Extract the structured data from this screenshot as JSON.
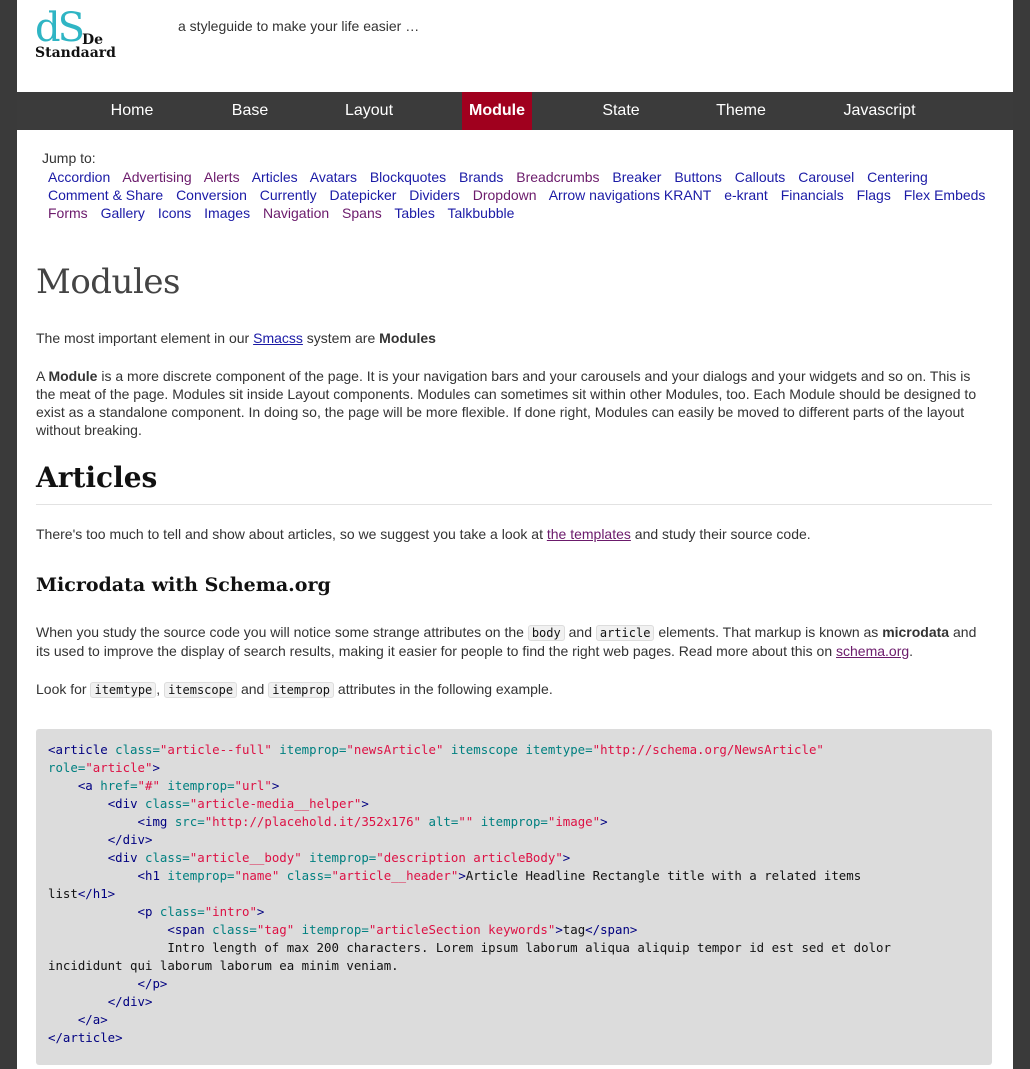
{
  "header": {
    "logo": {
      "ds": "dS",
      "de": "De",
      "standaard": "Standaard"
    },
    "tagline": "a styleguide to make your life easier …"
  },
  "nav": {
    "items": [
      {
        "label": "Home",
        "active": false
      },
      {
        "label": "Base",
        "active": false
      },
      {
        "label": "Layout",
        "active": false
      },
      {
        "label": "Module",
        "active": true
      },
      {
        "label": "State",
        "active": false
      },
      {
        "label": "Theme",
        "active": false
      },
      {
        "label": "Javascript",
        "active": false
      }
    ]
  },
  "jump": {
    "label": "Jump to:",
    "links": [
      "Accordion",
      "Advertising",
      "Alerts",
      "Articles",
      "Avatars",
      "Blockquotes",
      "Brands",
      "Breadcrumbs",
      "Breaker",
      "Buttons",
      "Callouts",
      "Carousel",
      "Centering",
      "Comment & Share",
      "Conversion",
      "Currently",
      "Datepicker",
      "Dividers",
      "Dropdown",
      "Arrow navigations KRANT",
      "e-krant",
      "Financials",
      "Flags",
      "Flex Embeds",
      "Forms",
      "Gallery",
      "Icons",
      "Images",
      "Navigation",
      "Spans",
      "Tables",
      "Talkbubble"
    ]
  },
  "content": {
    "title": "Modules",
    "intro": {
      "before": "The most important element in our ",
      "link": "Smacss",
      "after": " system are ",
      "strong": "Modules"
    },
    "module_para": {
      "before": "A ",
      "strong": "Module",
      "after": " is a more discrete component of the page. It is your navigation bars and your carousels and your dialogs and your widgets and so on. This is the meat of the page. Modules sit inside Layout components. Modules can sometimes sit within other Modules, too. Each Module should be designed to exist as a standalone component. In doing so, the page will be more flexible. If done right, Modules can easily be moved to different parts of the layout without breaking."
    },
    "articles_title": "Articles",
    "articles_para": {
      "before": "There's too much to tell and show about articles, so we suggest you take a look at ",
      "link": "the templates",
      "after": " and study their source code."
    },
    "micro_title": "Microdata with Schema.org",
    "micro_para": {
      "t1": "When you study the source code you will notice some strange attributes on the ",
      "c1": "body",
      "t2": " and ",
      "c2": "article",
      "t3": " elements. That markup is known as ",
      "strong": "microdata",
      "t4": " and its used to improve the display of search results, making it easier for people to find the right web pages. Read more about this on ",
      "link": "schema.org",
      "t5": "."
    },
    "look_para": {
      "t1": "Look for ",
      "c1": "itemtype",
      "t2": ", ",
      "c2": "itemscope",
      "t3": " and ",
      "c3": "itemprop",
      "t4": " attributes in the following example."
    }
  },
  "code_lines": [
    [
      [
        "t",
        "<article "
      ],
      [
        "a",
        "class="
      ],
      [
        "v",
        "\"article--full\""
      ],
      [
        "a",
        " itemprop="
      ],
      [
        "v",
        "\"newsArticle\""
      ],
      [
        "a",
        " itemscope itemtype="
      ],
      [
        "v",
        "\"http://schema.org/NewsArticle\""
      ]
    ],
    [
      [
        "a",
        "role="
      ],
      [
        "v",
        "\"article\""
      ],
      [
        "t",
        ">"
      ]
    ],
    [
      [
        "p",
        "    "
      ],
      [
        "t",
        "<a "
      ],
      [
        "a",
        "href="
      ],
      [
        "v",
        "\"#\""
      ],
      [
        "a",
        " itemprop="
      ],
      [
        "v",
        "\"url\""
      ],
      [
        "t",
        ">"
      ]
    ],
    [
      [
        "p",
        "        "
      ],
      [
        "t",
        "<div "
      ],
      [
        "a",
        "class="
      ],
      [
        "v",
        "\"article-media__helper\""
      ],
      [
        "t",
        ">"
      ]
    ],
    [
      [
        "p",
        "            "
      ],
      [
        "t",
        "<img "
      ],
      [
        "a",
        "src="
      ],
      [
        "v",
        "\"http://placehold.it/352x176\""
      ],
      [
        "a",
        " alt="
      ],
      [
        "v",
        "\"\""
      ],
      [
        "a",
        " itemprop="
      ],
      [
        "v",
        "\"image\""
      ],
      [
        "t",
        ">"
      ]
    ],
    [
      [
        "p",
        "        "
      ],
      [
        "t",
        "</div>"
      ]
    ],
    [
      [
        "p",
        "        "
      ],
      [
        "t",
        "<div "
      ],
      [
        "a",
        "class="
      ],
      [
        "v",
        "\"article__body\""
      ],
      [
        "a",
        " itemprop="
      ],
      [
        "v",
        "\"description articleBody\""
      ],
      [
        "t",
        ">"
      ]
    ],
    [
      [
        "p",
        "            "
      ],
      [
        "t",
        "<h1 "
      ],
      [
        "a",
        "itemprop="
      ],
      [
        "v",
        "\"name\""
      ],
      [
        "a",
        " class="
      ],
      [
        "v",
        "\"article__header\""
      ],
      [
        "t",
        ">"
      ],
      [
        "p",
        "Article Headline Rectangle title with a related items"
      ]
    ],
    [
      [
        "p",
        "list"
      ],
      [
        "t",
        "</h1>"
      ]
    ],
    [
      [
        "p",
        "            "
      ],
      [
        "t",
        "<p "
      ],
      [
        "a",
        "class="
      ],
      [
        "v",
        "\"intro\""
      ],
      [
        "t",
        ">"
      ]
    ],
    [
      [
        "p",
        "                "
      ],
      [
        "t",
        "<span "
      ],
      [
        "a",
        "class="
      ],
      [
        "v",
        "\"tag\""
      ],
      [
        "a",
        " itemprop="
      ],
      [
        "v",
        "\"articleSection keywords\""
      ],
      [
        "t",
        ">"
      ],
      [
        "p",
        "tag"
      ],
      [
        "t",
        "</span>"
      ]
    ],
    [
      [
        "p",
        "                Intro length of max 200 characters. Lorem ipsum laborum aliqua aliquip tempor id est sed et dolor"
      ]
    ],
    [
      [
        "p",
        "incididunt qui laborum laborum ea minim veniam."
      ]
    ],
    [
      [
        "p",
        "            "
      ],
      [
        "t",
        "</p>"
      ]
    ],
    [
      [
        "p",
        "        "
      ],
      [
        "t",
        "</div>"
      ]
    ],
    [
      [
        "p",
        "    "
      ],
      [
        "t",
        "</a>"
      ]
    ],
    [
      [
        "t",
        "</article>"
      ]
    ]
  ]
}
